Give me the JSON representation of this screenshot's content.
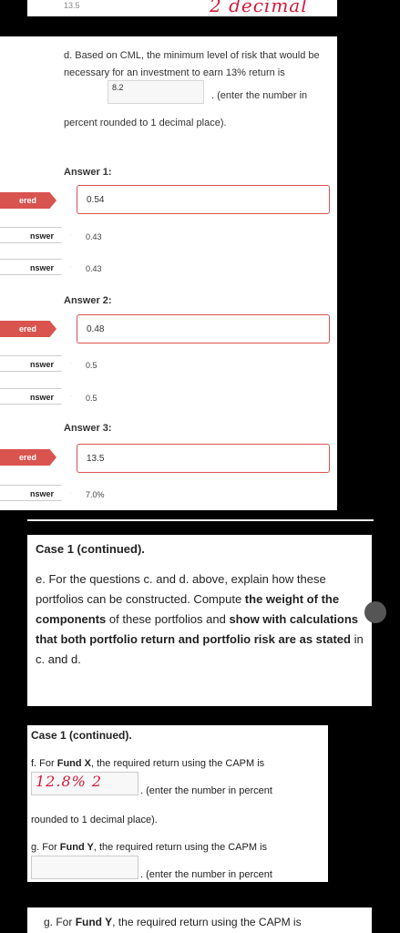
{
  "top_strip": {
    "number": "13.5",
    "handwriting": "2 decimal"
  },
  "question_d": {
    "text_before": "d. Based on CML, the minimum level of risk that would be necessary for an investment to earn 13% return is",
    "input_value": "8.2",
    "text_after": ". (enter the number in",
    "text_line3": "percent rounded to 1 decimal place)."
  },
  "answers": [
    {
      "label": "Answer 1:",
      "entered_tag": "ered",
      "entered_value": "0.54",
      "alts": [
        {
          "tag": "nswer",
          "value": "0.43"
        },
        {
          "tag": "nswer",
          "value": "0.43"
        }
      ]
    },
    {
      "label": "Answer 2:",
      "entered_tag": "ered",
      "entered_value": "0.48",
      "alts": [
        {
          "tag": "nswer",
          "value": "0.5"
        },
        {
          "tag": "nswer",
          "value": "0.5"
        }
      ]
    },
    {
      "label": "Answer 3:",
      "entered_tag": "ered",
      "entered_value": "13.5",
      "alts": [
        {
          "tag": "nswer",
          "value": "7.0%"
        }
      ]
    }
  ],
  "case_e": {
    "heading": "Case 1 (continued).",
    "p1": "e. For the questions c. and d. above, explain how these portfolios can be constructed. Compute ",
    "b1": "the weight of the components",
    "p2": " of these portfolios and ",
    "b2": "show with calculations that both portfolio return and portfolio risk are as stated",
    "p3": " in c. and d."
  },
  "case_f": {
    "heading": "Case 1 (continued).",
    "f_pre": "f. For ",
    "f_bold": "Fund X",
    "f_post": ", the required return using the CAPM is",
    "f_input_handwriting": "12.8% 2",
    "f_after": ". (enter the number in percent",
    "f_line3": "rounded to 1 decimal place).",
    "g_pre": "g. For ",
    "g_bold": "Fund Y",
    "g_post": ", the required return using the CAPM is",
    "g_after": ". (enter the number in percent"
  },
  "bottom": {
    "g_pre": "g. For ",
    "g_bold": "Fund Y",
    "g_post": ", the required return using the CAPM is"
  }
}
